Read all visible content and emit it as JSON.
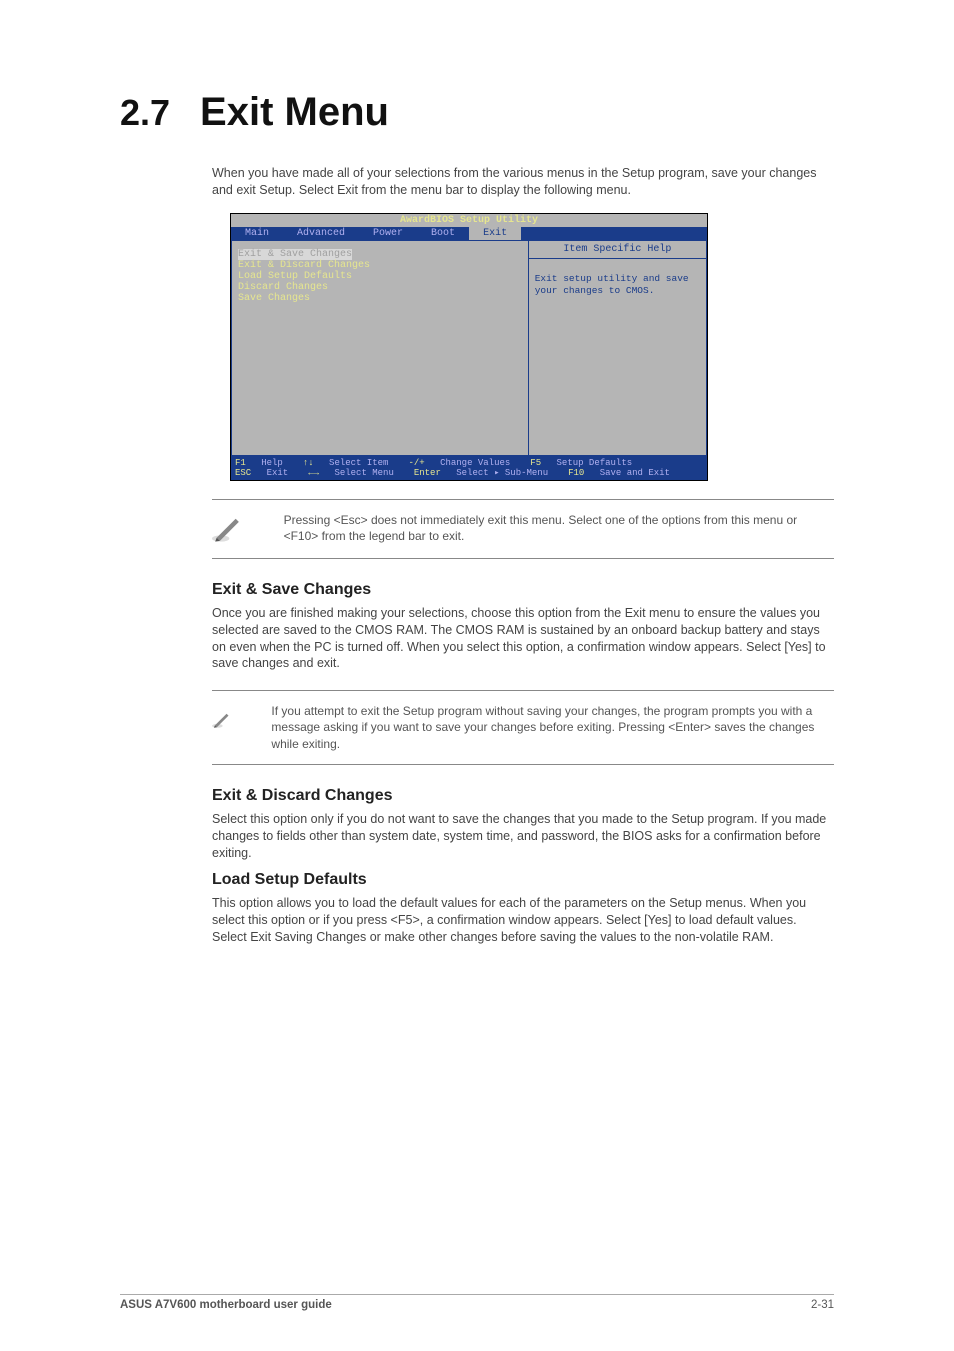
{
  "section": {
    "number": "2.7",
    "title": "Exit Menu"
  },
  "intro": "When you have made all of your selections from the various menus in the Setup program, save your changes and exit Setup. Select Exit from the menu bar to display the following menu.",
  "bios": {
    "title": "AwardBIOS Setup Utility",
    "tabs": {
      "t0": "Main",
      "t1": "Advanced",
      "t2": "Power",
      "t3": "Boot",
      "t4": "Exit"
    },
    "menu": {
      "m0": "Exit & Save Changes",
      "m1": "Exit & Discard Changes",
      "m2": "Load Setup Defaults",
      "m3": "Discard Changes",
      "m4": "Save Changes"
    },
    "help": {
      "title": "Item Specific Help",
      "body": "Exit setup utility and save your changes to CMOS."
    },
    "footer": {
      "f1k": "F1",
      "f1": "Help",
      "udk": "↑↓",
      "ud": "Select Item",
      "pmk": "-/+",
      "pm": "Change Values",
      "f5k": "F5",
      "f5": "Setup Defaults",
      "esck": "ESC",
      "esc": "Exit",
      "lrk": "←→",
      "lr": "Select Menu",
      "entk": "Enter",
      "ent": "Select ▸ Sub-Menu",
      "f10k": "F10",
      "f10": "Save and Exit"
    }
  },
  "note1": "Pressing <Esc> does not immediately exit this menu. Select one of the options from this menu or <F10> from the legend bar to exit.",
  "sub1": {
    "heading": "Exit & Save Changes",
    "p1": "Once you are finished making your selections, choose this option from the Exit menu to ensure the values you selected are saved to the CMOS RAM. The CMOS RAM is sustained by an onboard backup battery and stays on even when the PC is turned off. When you select this option, a confirmation window appears. Select [Yes] to save changes and exit."
  },
  "note2": "If you attempt to exit the Setup program without saving your changes, the program prompts you with a message asking if you want to save your changes before exiting. Pressing <Enter> saves the changes while exiting.",
  "sub2": {
    "heading": "Exit & Discard Changes",
    "p1": "Select this option only if you do not want to save the changes that you made to the Setup program. If you made changes to fields other than system date, system time, and password, the BIOS asks for a confirmation before exiting."
  },
  "sub3": {
    "heading": "Load Setup Defaults",
    "p1": "This option allows you to load the default values for each of the parameters on the Setup menus. When you select this option or if you press <F5>, a confirmation window appears. Select [Yes] to load default values. Select Exit Saving Changes or make other changes before saving the values to the non-volatile RAM."
  },
  "footer": {
    "left": "ASUS A7V600 motherboard user guide",
    "right": "2-31"
  }
}
